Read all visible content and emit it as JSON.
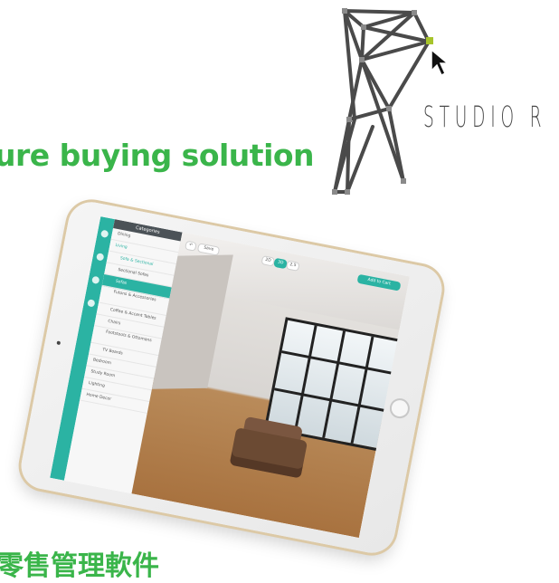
{
  "brand": {
    "name": "STUDIO R"
  },
  "headline": "ure buying solution",
  "cjk_text": "零售管理軟件",
  "colors": {
    "accent_green": "#3ab54a",
    "teal": "#2bb3a3",
    "logo_gray": "#4a4a4a",
    "logo_node_highlight": "#a7c42b"
  },
  "app": {
    "menu_header": "Categories",
    "menu_items": [
      "Dining",
      "Living",
      "Sofa & Sectional",
      "Sectional Sofas",
      "Sofas",
      "Futons & Accessories",
      "Coffee & Accent Tables",
      "Chairs",
      "Footstools & Ottomans",
      "TV Boards",
      "Bedroom",
      "Study Room",
      "Lighting",
      "Home Decor"
    ],
    "toolbar": {
      "save": "Save",
      "view_2d": "2D",
      "view_3d": "3D",
      "view_25d": "2.5",
      "add_to_cart": "Add to Cart"
    }
  }
}
